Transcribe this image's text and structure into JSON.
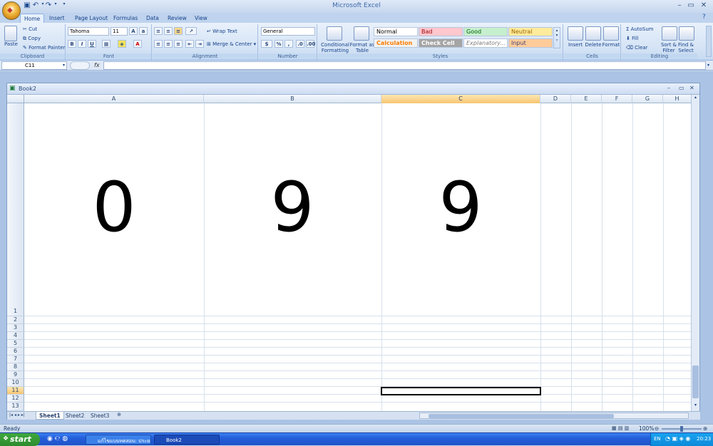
{
  "window": {
    "title": "Microsoft Excel"
  },
  "qat": {
    "save_icon": "save-icon",
    "undo_icon": "undo-icon",
    "redo_icon": "redo-icon"
  },
  "tabs": [
    "Home",
    "Insert",
    "Page Layout",
    "Formulas",
    "Data",
    "Review",
    "View"
  ],
  "ribbon": {
    "clipboard": {
      "label": "Clipboard",
      "paste": "Paste",
      "cut": "Cut",
      "copy": "Copy",
      "format_painter": "Format Painter"
    },
    "font": {
      "label": "Font",
      "font_name": "Tahoma",
      "font_size": "11"
    },
    "alignment": {
      "label": "Alignment",
      "wrap_text": "Wrap Text",
      "merge_center": "Merge & Center"
    },
    "number": {
      "label": "Number",
      "format": "General"
    },
    "styles": {
      "label": "Styles",
      "conditional": "Conditional Formatting",
      "format_table": "Format as Table",
      "cells": [
        {
          "name": "Normal",
          "bg": "#ffffff",
          "fg": "#000000"
        },
        {
          "name": "Bad",
          "bg": "#ffc7ce",
          "fg": "#9c0006"
        },
        {
          "name": "Good",
          "bg": "#c6efce",
          "fg": "#006100"
        },
        {
          "name": "Neutral",
          "bg": "#ffeb9c",
          "fg": "#9c6500"
        },
        {
          "name": "Calculation",
          "bg": "#f2f2f2",
          "fg": "#fa7d00"
        },
        {
          "name": "Check Cell",
          "bg": "#a5a5a5",
          "fg": "#ffffff"
        },
        {
          "name": "Explanatory...",
          "bg": "#ffffff",
          "fg": "#7f7f7f"
        },
        {
          "name": "Input",
          "bg": "#ffcc99",
          "fg": "#3f3f76"
        }
      ]
    },
    "cells": {
      "label": "Cells",
      "insert": "Insert",
      "delete": "Delete",
      "format": "Format"
    },
    "editing": {
      "label": "Editing",
      "autosum": "AutoSum",
      "fill": "Fill",
      "clear": "Clear",
      "sort": "Sort & Filter",
      "find": "Find & Select"
    }
  },
  "formula_bar": {
    "name_box": "C11",
    "fx": "fx",
    "value": ""
  },
  "workbook": {
    "title": "Book2",
    "columns": [
      "A",
      "B",
      "C",
      "D",
      "E",
      "F",
      "G",
      "H"
    ],
    "selected_column": "C",
    "rows": [
      "1",
      "2",
      "3",
      "4",
      "5",
      "6",
      "7",
      "8",
      "9",
      "10",
      "11",
      "12",
      "13"
    ],
    "selected_row": "11",
    "cells": {
      "A1": "0",
      "B1": "9",
      "C1": "9"
    },
    "sheets": [
      "Sheet1",
      "Sheet2",
      "Sheet3"
    ],
    "active_sheet": "Sheet1"
  },
  "status": {
    "mode": "Ready",
    "zoom": "100%"
  },
  "taskbar": {
    "start": "start",
    "tasks": [
      "แก้ไขแบบทดสอบ: ประยะ...",
      "Book2"
    ],
    "tray": {
      "lang": "EN",
      "clock": "20:23"
    }
  }
}
